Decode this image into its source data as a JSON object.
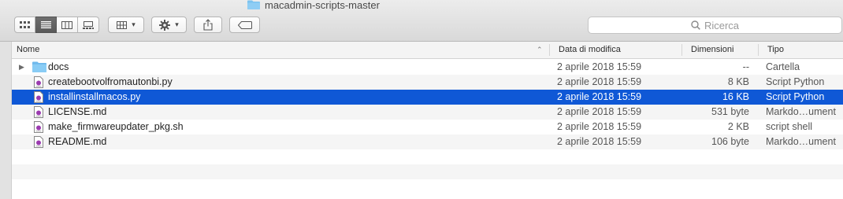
{
  "window": {
    "title": "macadmin-scripts-master"
  },
  "search": {
    "placeholder": "Ricerca"
  },
  "columns": {
    "name": "Nome",
    "date": "Data di modifica",
    "size": "Dimensioni",
    "type": "Tipo"
  },
  "files": [
    {
      "name": "docs",
      "date": "2 aprile 2018 15:59",
      "size": "--",
      "type": "Cartella",
      "icon": "folder-icon"
    },
    {
      "name": "createbootvolfromautonbi.py",
      "date": "2 aprile 2018 15:59",
      "size": "8 KB",
      "type": "Script Python",
      "icon": "script-file-icon"
    },
    {
      "name": "installinstallmacos.py",
      "date": "2 aprile 2018 15:59",
      "size": "16 KB",
      "type": "Script Python",
      "icon": "script-file-icon",
      "selected": true
    },
    {
      "name": "LICENSE.md",
      "date": "2 aprile 2018 15:59",
      "size": "531 byte",
      "type": "Markdo…ument",
      "icon": "script-file-icon"
    },
    {
      "name": "make_firmwareupdater_pkg.sh",
      "date": "2 aprile 2018 15:59",
      "size": "2 KB",
      "type": "script shell",
      "icon": "script-file-icon"
    },
    {
      "name": "README.md",
      "date": "2 aprile 2018 15:59",
      "size": "106 byte",
      "type": "Markdo…ument",
      "icon": "script-file-icon"
    }
  ],
  "colors": {
    "selection": "#0f58d6",
    "folder": "#7cc3f0"
  }
}
